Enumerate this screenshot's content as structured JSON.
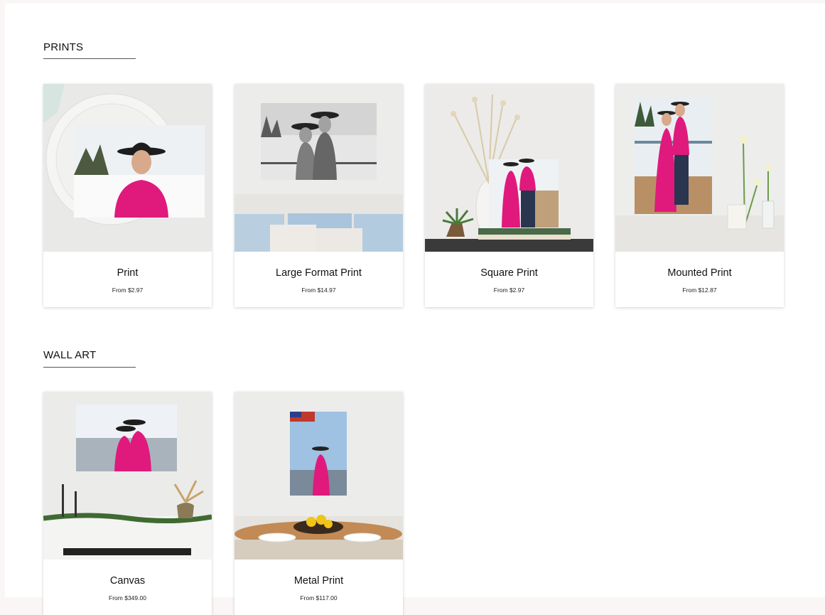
{
  "sections": [
    {
      "title": "PRINTS",
      "products": [
        {
          "name": "Print",
          "price": "From $2.97"
        },
        {
          "name": "Large Format Print",
          "price": "From $14.97"
        },
        {
          "name": "Square Print",
          "price": "From $2.97"
        },
        {
          "name": "Mounted Print",
          "price": "From $12.87"
        }
      ]
    },
    {
      "title": "WALL ART",
      "products": [
        {
          "name": "Canvas",
          "price": "From $349.00"
        },
        {
          "name": "Metal Print",
          "price": "From $117.00"
        }
      ]
    }
  ],
  "colors": {
    "accent_pink": "#e0197d",
    "rule": "#555555",
    "page_bg": "#fbf6f6"
  }
}
